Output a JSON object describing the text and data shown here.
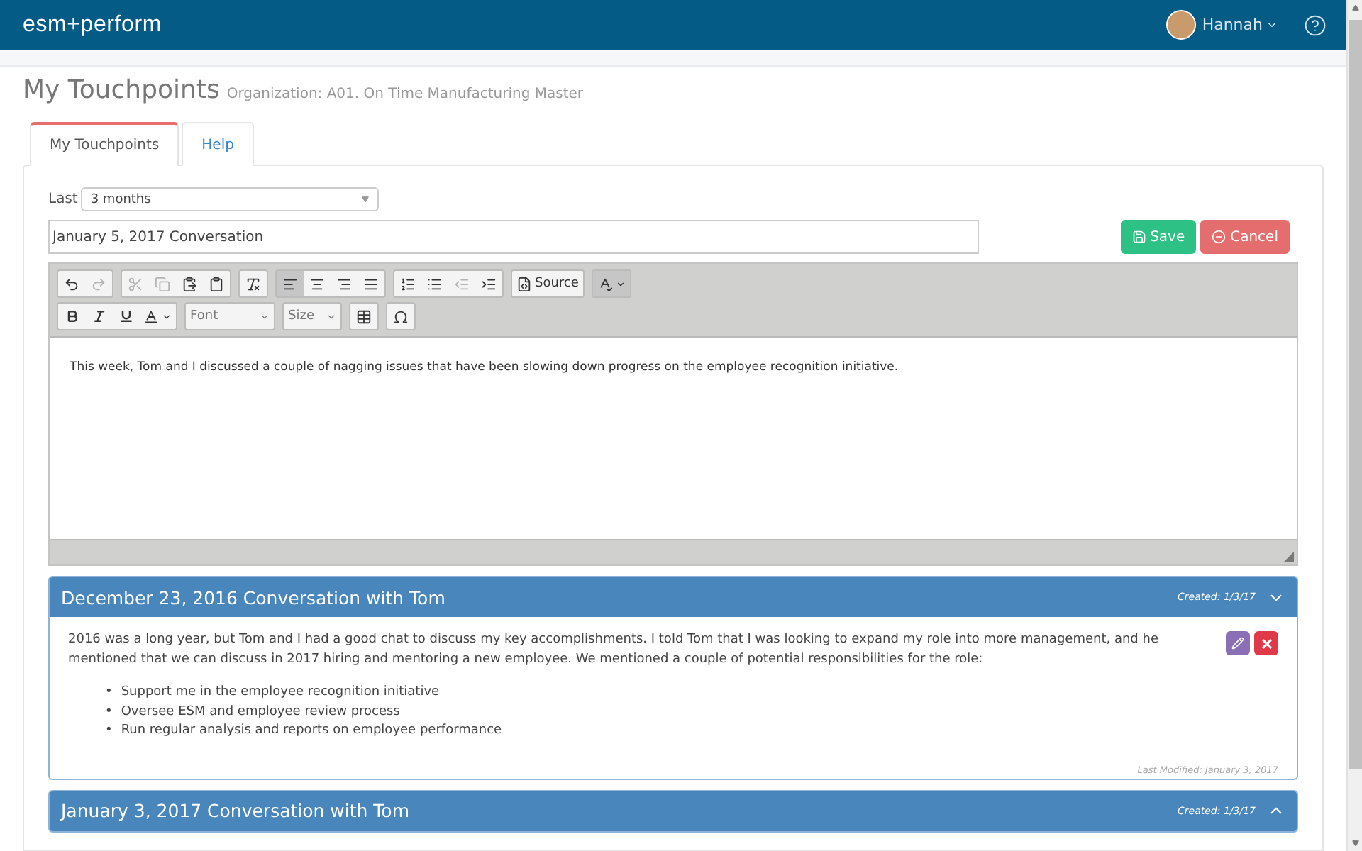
{
  "header": {
    "logo": "esm+perform",
    "user": "Hannah"
  },
  "page": {
    "title": "My Touchpoints",
    "subtitle": "Organization: A01. On Time Manufacturing Master"
  },
  "tabs": [
    {
      "label": "My Touchpoints",
      "selected": true
    },
    {
      "label": "Help",
      "selected": false
    }
  ],
  "filter": {
    "label": "Last",
    "value": "3 months"
  },
  "entry": {
    "title": "January 5, 2017 Conversation",
    "buttons": [
      {
        "kind": "save",
        "label": "Save"
      },
      {
        "kind": "cancel",
        "label": "Cancel"
      }
    ]
  },
  "toolbar": [
    [
      {
        "kind": "icon",
        "disabled": false,
        "selected": false
      },
      {
        "kind": "icon",
        "disabled": true,
        "selected": false
      }
    ],
    [
      {
        "kind": "icon",
        "disabled": true,
        "selected": false
      },
      {
        "kind": "icon",
        "disabled": true,
        "selected": false
      },
      {
        "kind": "icon",
        "disabled": false,
        "selected": false
      },
      {
        "kind": "icon",
        "disabled": false,
        "selected": false
      }
    ],
    [
      {
        "kind": "icon",
        "disabled": false,
        "selected": false
      }
    ],
    [
      {
        "kind": "icon",
        "disabled": false,
        "selected": true
      },
      {
        "kind": "icon",
        "disabled": false,
        "selected": false
      },
      {
        "kind": "icon",
        "disabled": false,
        "selected": false
      },
      {
        "kind": "icon",
        "disabled": false,
        "selected": false
      }
    ],
    [
      {
        "kind": "icon",
        "disabled": false,
        "selected": false
      },
      {
        "kind": "icon",
        "disabled": false,
        "selected": false
      },
      {
        "kind": "icon",
        "disabled": true,
        "selected": false
      },
      {
        "kind": "icon",
        "disabled": false,
        "selected": false
      }
    ],
    [
      {
        "kind": "text",
        "label": "Source",
        "disabled": false,
        "selected": false
      }
    ],
    [
      {
        "kind": "menu",
        "disabled": false,
        "selected": true
      }
    ]
  ],
  "toolbar2": [
    {
      "kind": "format"
    },
    {
      "kind": "combo",
      "label": "Font"
    },
    {
      "kind": "combo",
      "label": "Size"
    },
    {
      "kind": "table"
    },
    {
      "kind": "symbol"
    }
  ],
  "editor_text": "This week, Tom and I discussed a couple of nagging issues that have been slowing down progress on the employee recognition initiative.",
  "conversations": [
    {
      "title": "December 23, 2016 Conversation with Tom",
      "created": "Created: 1/3/17",
      "expanded": true,
      "body": "2016 was a long year, but Tom and I had a good chat to discuss my key accomplishments.  I told Tom that I was looking to expand my role into more management, and he mentioned that we can discuss in 2017 hiring and mentoring a new employee.  We mentioned a couple of potential responsibilities for the role:",
      "bullets": [
        {
          "marker": "•",
          "text": "Support me in the employee recognition initiative"
        },
        {
          "marker": "•",
          "text": "Oversee ESM and employee review process"
        },
        {
          "marker": "•",
          "text": "Run regular analysis and reports on employee performance"
        }
      ],
      "modified": "Last Modified: January 3, 2017"
    },
    {
      "title": "January 3, 2017 Conversation with Tom",
      "created": "Created: 1/3/17",
      "expanded": false
    }
  ]
}
